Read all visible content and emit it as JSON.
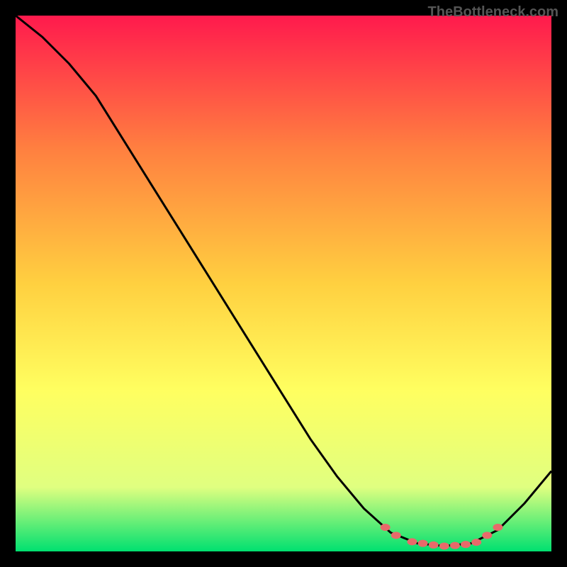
{
  "watermark": "TheBottleneck.com",
  "chart_data": {
    "type": "line",
    "title": "",
    "xlabel": "",
    "ylabel": "",
    "xlim": [
      0,
      100
    ],
    "ylim": [
      0,
      100
    ],
    "background_gradient": {
      "top": "#ff1a4d",
      "mid_upper": "#ff8040",
      "mid": "#ffd040",
      "mid_lower": "#ffff60",
      "lower": "#e0ff80",
      "bottom": "#00e070"
    },
    "curve": [
      {
        "x": 0,
        "y": 100
      },
      {
        "x": 5,
        "y": 96
      },
      {
        "x": 10,
        "y": 91
      },
      {
        "x": 15,
        "y": 85
      },
      {
        "x": 20,
        "y": 77
      },
      {
        "x": 25,
        "y": 69
      },
      {
        "x": 30,
        "y": 61
      },
      {
        "x": 35,
        "y": 53
      },
      {
        "x": 40,
        "y": 45
      },
      {
        "x": 45,
        "y": 37
      },
      {
        "x": 50,
        "y": 29
      },
      {
        "x": 55,
        "y": 21
      },
      {
        "x": 60,
        "y": 14
      },
      {
        "x": 65,
        "y": 8
      },
      {
        "x": 70,
        "y": 3.5
      },
      {
        "x": 75,
        "y": 1.5
      },
      {
        "x": 80,
        "y": 1
      },
      {
        "x": 85,
        "y": 1.5
      },
      {
        "x": 90,
        "y": 4
      },
      {
        "x": 95,
        "y": 9
      },
      {
        "x": 100,
        "y": 15
      }
    ],
    "dots": [
      {
        "x": 69,
        "y": 4.5
      },
      {
        "x": 71,
        "y": 3
      },
      {
        "x": 74,
        "y": 1.8
      },
      {
        "x": 76,
        "y": 1.5
      },
      {
        "x": 78,
        "y": 1.2
      },
      {
        "x": 80,
        "y": 1
      },
      {
        "x": 82,
        "y": 1.1
      },
      {
        "x": 84,
        "y": 1.3
      },
      {
        "x": 86,
        "y": 1.7
      },
      {
        "x": 88,
        "y": 3
      },
      {
        "x": 90,
        "y": 4.5
      }
    ],
    "dot_style": {
      "fill": "#e86a6a",
      "rx": 7,
      "ry": 5
    }
  }
}
